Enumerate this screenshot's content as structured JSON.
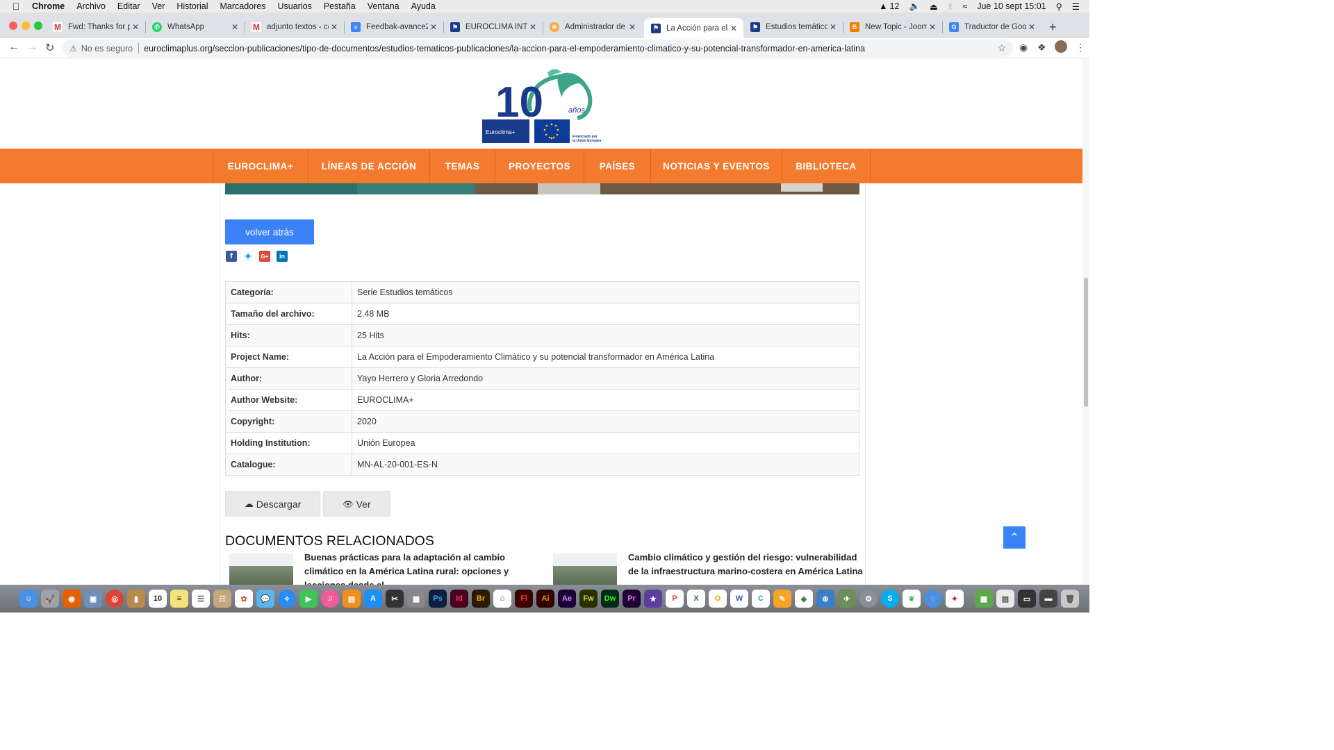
{
  "menubar": {
    "app": "Chrome",
    "items": [
      "Archivo",
      "Editar",
      "Ver",
      "Historial",
      "Marcadores",
      "Usuarios",
      "Pestaña",
      "Ventana",
      "Ayuda"
    ],
    "status_count": "12",
    "datetime": "Jue 10 sept  15:01"
  },
  "tabs": [
    {
      "title": "Fwd: Thanks for pu",
      "icon": "gmail-icon"
    },
    {
      "title": "WhatsApp",
      "icon": "whatsapp-icon"
    },
    {
      "title": "adjunto textos - co",
      "icon": "gmail-icon"
    },
    {
      "title": "Feedbak-avance2",
      "icon": "docs-icon"
    },
    {
      "title": "EUROCLIMA INTRA",
      "icon": "euroclima-icon"
    },
    {
      "title": "Administrador de d",
      "icon": "joomla-icon"
    },
    {
      "title": "La Acción para el E",
      "icon": "euroclima-icon"
    },
    {
      "title": "Estudios temáticos",
      "icon": "euroclima-icon"
    },
    {
      "title": "New Topic - Joom",
      "icon": "blogger-icon"
    },
    {
      "title": "Traductor de Goog",
      "icon": "translate-icon"
    }
  ],
  "toolbar": {
    "security_label": "No es seguro",
    "url": "euroclimaplus.org/seccion-publicaciones/tipo-de-documentos/estudios-tematicos-publicaciones/la-accion-para-el-empoderamiento-climatico-y-su-potencial-transformador-en-america-latina"
  },
  "logo": {
    "number": "10",
    "years": "años",
    "brand": "Euroclima+",
    "funding": "Financiado por la Unión Europea"
  },
  "nav": [
    "EUROCLIMA+",
    "LÍNEAS DE ACCIÓN",
    "TEMAS",
    "PROYECTOS",
    "PAÍSES",
    "NOTICIAS Y EVENTOS",
    "BIBLIOTECA"
  ],
  "back_button": "volver atrás",
  "social": [
    "facebook-icon",
    "twitter-icon",
    "googleplus-icon",
    "linkedin-icon"
  ],
  "meta": [
    {
      "key": "Categoría:",
      "value": "Serie Estudios temáticos"
    },
    {
      "key": "Tamaño del archivo:",
      "value": "2.48 MB"
    },
    {
      "key": "Hits:",
      "value": "25 Hits"
    },
    {
      "key": "Project Name:",
      "value": "La Acción para el Empoderamiento Climático y su potencial transformador en América Latina"
    },
    {
      "key": "Author:",
      "value": "Yayo Herrero y Gloria Arredondo"
    },
    {
      "key": "Author Website:",
      "value": "EUROCLIMA+"
    },
    {
      "key": "Copyright:",
      "value": "2020"
    },
    {
      "key": "Holding Institution:",
      "value": "Unión Europea"
    },
    {
      "key": "Catalogue:",
      "value": "MN-AL-20-001-ES-N"
    }
  ],
  "download_label": "Descargar",
  "view_label": "Ver",
  "related_title": "DOCUMENTOS RELACIONADOS",
  "related": [
    {
      "title": "Buenas prácticas para la adaptación al cambio climático en la América Latina rural: opciones y lecciones desde el"
    },
    {
      "title": "Cambio climático y gestión del riesgo: vulnerabilidad de la infraestructura marino-costera en América Latina"
    }
  ],
  "colors": {
    "nav_orange": "#f47a2f",
    "button_blue": "#3b82f6",
    "logo_navy": "#1a3a8a",
    "logo_green": "#3fa58a"
  }
}
